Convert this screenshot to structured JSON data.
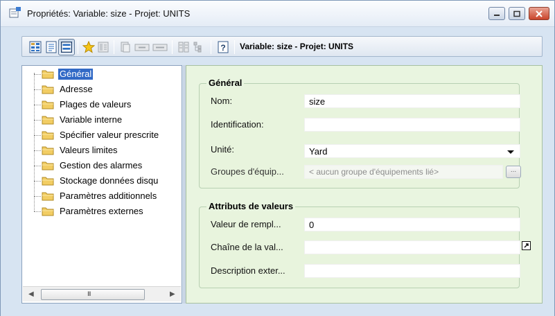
{
  "window": {
    "title": "Propriétés: Variable: size - Projet: UNITS"
  },
  "toolbar": {
    "title": "Variable: size - Projet: UNITS",
    "icons": [
      "grid-icon",
      "list-icon",
      "form-view-icon",
      "star-icon",
      "properties-icon",
      "copy-icon",
      "field-icon",
      "field2-icon",
      "split-icon",
      "tree-icon",
      "help-icon"
    ]
  },
  "tree": {
    "items": [
      {
        "label": "Général",
        "selected": true
      },
      {
        "label": "Adresse"
      },
      {
        "label": "Plages de valeurs"
      },
      {
        "label": "Variable interne"
      },
      {
        "label": "Spécifier valeur prescrite"
      },
      {
        "label": "Valeurs limites"
      },
      {
        "label": "Gestion des alarmes"
      },
      {
        "label": "Stockage données disqu"
      },
      {
        "label": "Paramètres additionnels"
      },
      {
        "label": "Paramètres externes"
      }
    ],
    "scroll_grip": "III"
  },
  "general": {
    "title": "Général",
    "name_label": "Nom:",
    "name_value": "size",
    "id_label": "Identification:",
    "id_value": "",
    "unit_label": "Unité:",
    "unit_value": "Yard",
    "groups_label": "Groupes d'équip...",
    "groups_placeholder": "< aucun groupe d'équipements lié>",
    "groups_button": "..."
  },
  "attributes": {
    "title": "Attributs de valeurs",
    "replace_label": "Valeur de rempl...",
    "replace_value": "0",
    "chain_label": "Chaîne de la val...",
    "chain_value": "",
    "desc_label": "Description exter...",
    "desc_value": ""
  }
}
